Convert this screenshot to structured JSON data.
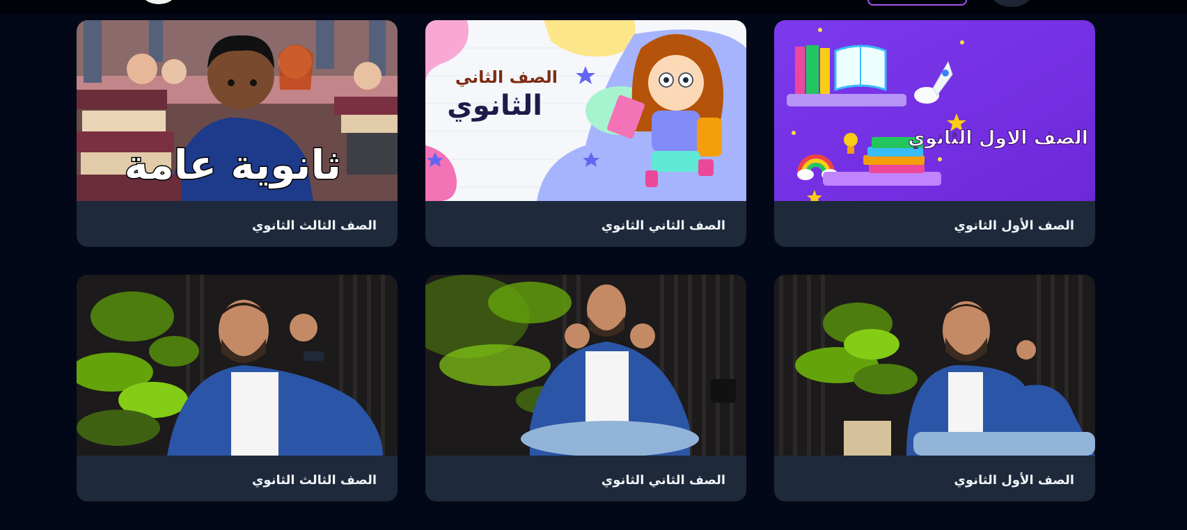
{
  "header": {
    "logo_icon": "logo-icon",
    "login_button_accent": "#a855f7",
    "user_icon": "user-icon"
  },
  "courses": [
    {
      "title": "الصف الأول الثانوي",
      "thumbnail_text": "الصف الاول الثانوي"
    },
    {
      "title": "الصف الثاني الثانوي",
      "thumbnail_text_line1": "الصف الثاني",
      "thumbnail_text_line2": "الثانوي"
    },
    {
      "title": "الصف الثالث الثانوي",
      "thumbnail_text": "ثانوية عامة"
    },
    {
      "title": "الصف الأول الثانوي"
    },
    {
      "title": "الصف الثاني الثانوي"
    },
    {
      "title": "الصف الثالث الثانوي"
    }
  ],
  "colors": {
    "page_background": "#020817",
    "card_background": "#1e293b",
    "title_text": "#f1f5f9"
  }
}
